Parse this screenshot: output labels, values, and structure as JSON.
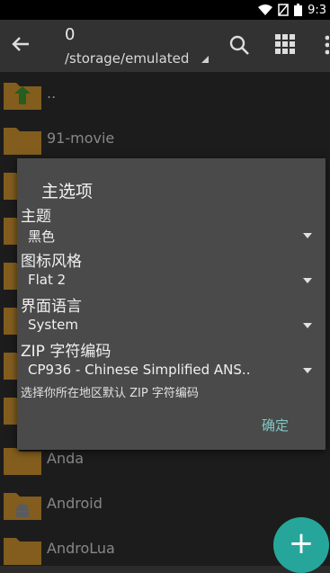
{
  "status_bar": {
    "time": "9:3"
  },
  "app_bar": {
    "count": "0",
    "path": "/storage/emulated"
  },
  "files": [
    {
      "name": "..",
      "type": "parent"
    },
    {
      "name": "91-movie",
      "type": "folder"
    },
    {
      "name": "",
      "type": "folder"
    },
    {
      "name": "",
      "type": "folder"
    },
    {
      "name": "",
      "type": "folder"
    },
    {
      "name": "",
      "type": "folder"
    },
    {
      "name": "",
      "type": "folder"
    },
    {
      "name": "",
      "type": "folder"
    },
    {
      "name": "Anda",
      "type": "folder"
    },
    {
      "name": "Android",
      "type": "android"
    },
    {
      "name": "AndroLua",
      "type": "folder"
    }
  ],
  "dialog": {
    "title": "主选项",
    "theme_label": "主题",
    "theme_value": "黑色",
    "icon_style_label": "图标风格",
    "icon_style_value": "Flat 2",
    "language_label": "界面语言",
    "language_value": "System",
    "zip_label": "ZIP 字符编码",
    "zip_value": "CP936 - Chinese Simplified ANS..",
    "zip_hint": "选择你所在地区默认 ZIP 字符编码",
    "ok_label": "确定"
  },
  "colors": {
    "accent": "#26a69a",
    "folder": "#c8902f",
    "dialog_bg": "#4a4a4a"
  }
}
